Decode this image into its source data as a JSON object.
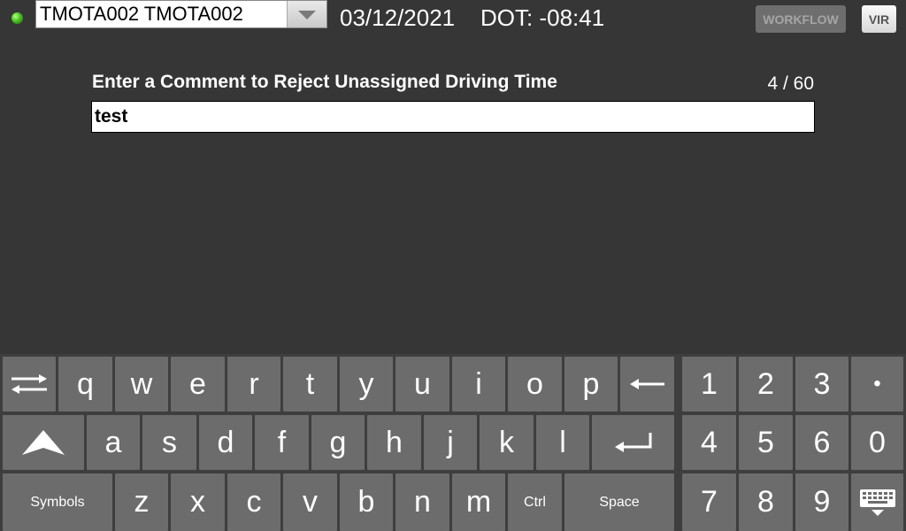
{
  "header": {
    "driver_value": "TMOTA002 TMOTA002",
    "date": "03/12/2021",
    "dot_clock": "DOT: -08:41",
    "workflow_label": "WORKFLOW",
    "vir_label": "VIR"
  },
  "form": {
    "prompt": "Enter a Comment to Reject Unassigned Driving Time",
    "char_count": "4 / 60",
    "comment_value": "test"
  },
  "keyboard": {
    "row1": [
      "q",
      "w",
      "e",
      "r",
      "t",
      "y",
      "u",
      "i",
      "o",
      "p"
    ],
    "row2": [
      "a",
      "s",
      "d",
      "f",
      "g",
      "h",
      "j",
      "k",
      "l"
    ],
    "row3": [
      "z",
      "x",
      "c",
      "v",
      "b",
      "n",
      "m"
    ],
    "symbols_label": "Symbols",
    "ctrl_label": "Ctrl",
    "space_label": "Space",
    "numpad": [
      [
        "1",
        "2",
        "3",
        "•"
      ],
      [
        "4",
        "5",
        "6",
        "0"
      ],
      [
        "7",
        "8",
        "9"
      ]
    ]
  },
  "icons": {
    "status": "status-dot-icon",
    "dropdown": "chevron-down-icon",
    "tab": "tab-arrows-icon",
    "shift": "shift-icon",
    "backspace": "backspace-icon",
    "enter": "enter-icon",
    "hide_keyboard": "hide-keyboard-icon"
  },
  "colors": {
    "background": "#363636",
    "key": "#6c6c6c",
    "status_led": "#48c21e"
  }
}
